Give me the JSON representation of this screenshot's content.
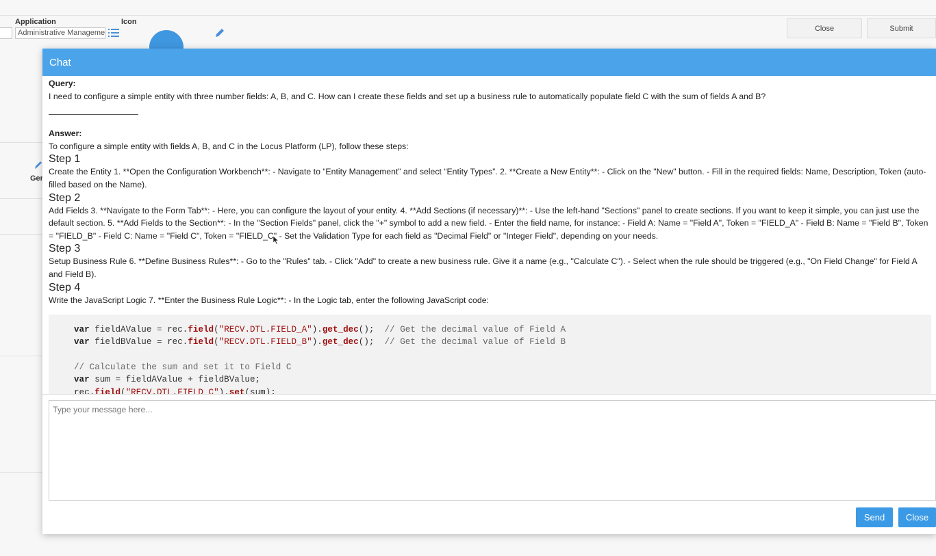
{
  "background": {
    "application_label": "Application",
    "icon_label": "Icon",
    "application_value": "Administrative Management",
    "close_label": "Close",
    "submit_label": "Submit",
    "side_text": "Ger"
  },
  "chat": {
    "title": "Chat",
    "query_label": "Query:",
    "query_text": "I need to configure a simple entity with three number fields: A, B, and C. How can I create these fields and set up a business rule to automatically populate field C with the sum of fields A and B?",
    "answer_label": "Answer:",
    "intro": "To configure a simple entity with fields A, B, and C in the Locus Platform (LP), follow these steps:",
    "steps": [
      {
        "title": "Step 1",
        "text": "Create the Entity 1. **Open the Configuration Workbench**: - Navigate to “Entity Management” and select “Entity Types”. 2. **Create a New Entity**: - Click on the \"New\" button. - Fill in the required fields: Name, Description, Token (auto-filled based on the Name)."
      },
      {
        "title": "Step 2",
        "text": "Add Fields 3. **Navigate to the Form Tab**: - Here, you can configure the layout of your entity. 4. **Add Sections (if necessary)**: - Use the left-hand \"Sections\" panel to create sections. If you want to keep it simple, you can just use the default section. 5. **Add Fields to the Section**: - In the \"Section Fields\" panel, click the \"+\" symbol to add a new field. - Enter the field name, for instance: - Field A: Name = \"Field A\", Token = \"FIELD_A\" - Field B: Name = \"Field B\", Token = \"FIELD_B\" - Field C: Name = \"Field C\", Token = \"FIELD_C\" - Set the Validation Type for each field as \"Decimal Field\" or \"Integer Field\", depending on your needs."
      },
      {
        "title": "Step 3",
        "text": "Setup Business Rule 6. **Define Business Rules**: - Go to the \"Rules\" tab. - Click \"Add\" to create a new business rule. Give it a name (e.g., \"Calculate C\"). - Select when the rule should be triggered (e.g., \"On Field Change\" for Field A and Field B)."
      },
      {
        "title": "Step 4",
        "text": "Write the JavaScript Logic 7. **Enter the Business Rule Logic**: - In the Logic tab, enter the following JavaScript code:"
      }
    ],
    "code": {
      "kw_var": "var",
      "fn_field": "field",
      "fn_get_dec": "get_dec",
      "fn_set": "set",
      "line1_name": "fieldAValue",
      "line1_str": "\"RECV.DTL.FIELD_A\"",
      "line1_comment": "// Get the decimal value of Field A",
      "line2_name": "fieldBValue",
      "line2_str": "\"RECV.DTL.FIELD_B\"",
      "line2_comment": "// Get the decimal value of Field B",
      "comment_calc": "// Calculate the sum and set it to Field C",
      "line4_text": "sum = fieldAValue + fieldBValue;",
      "line5_str": "\"RECV.DTL.FIELD_C\"",
      "rec": "rec"
    },
    "input_placeholder": "Type your message here...",
    "send_label": "Send",
    "close_label": "Close"
  },
  "colors": {
    "header": "#4ba4ea",
    "button": "#3b9ae6",
    "avatar": "#3f97e0"
  }
}
